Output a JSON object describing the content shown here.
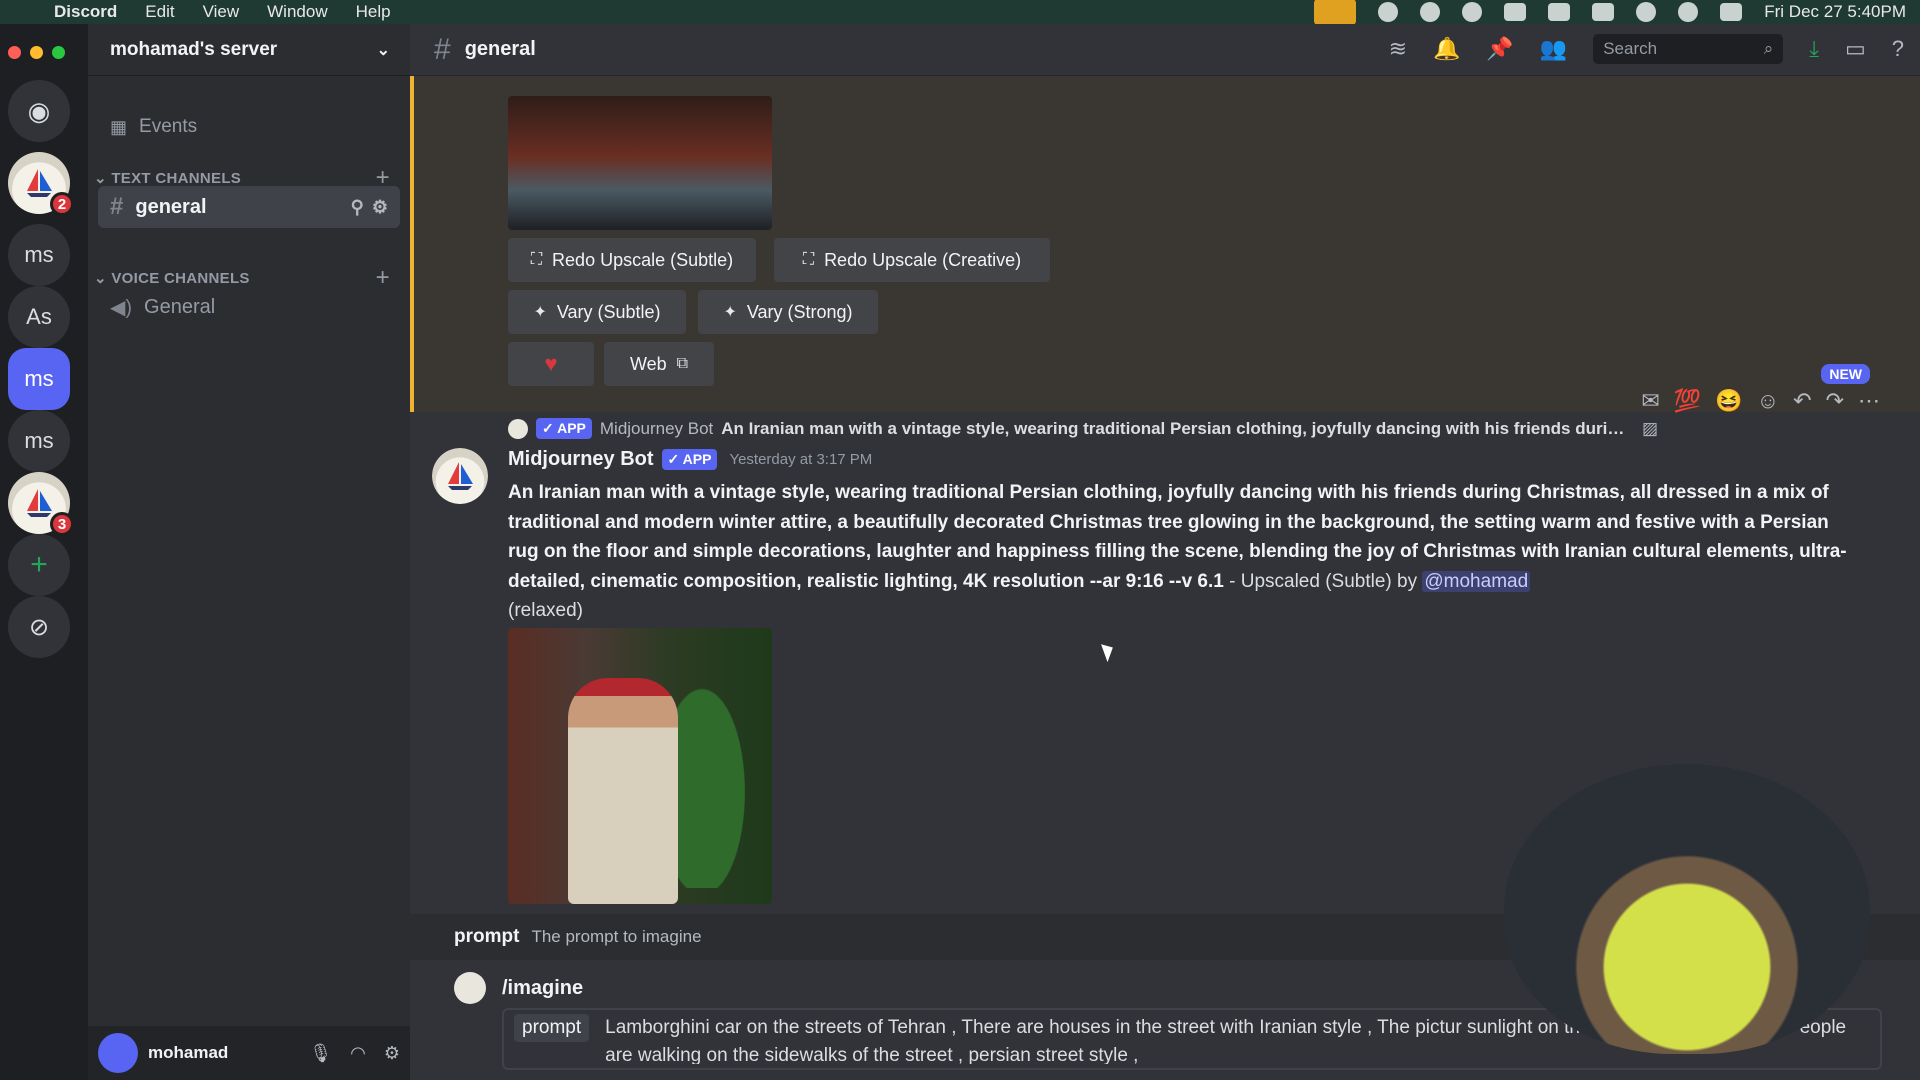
{
  "menubar": {
    "app": "Discord",
    "items": [
      "Edit",
      "View",
      "Window",
      "Help"
    ],
    "clock": "Fri Dec 27  5:40PM"
  },
  "rail": {
    "servers": [
      {
        "label": "",
        "badge": "2",
        "icon": "sailboat-icon"
      },
      {
        "label": "ms",
        "badge": ""
      },
      {
        "label": "As",
        "badge": ""
      },
      {
        "label": "ms",
        "badge": "",
        "selected": true
      },
      {
        "label": "ms",
        "badge": ""
      },
      {
        "label": "",
        "badge": "3",
        "icon": "sailboat-icon"
      }
    ],
    "add": "+",
    "explore": "compass-icon"
  },
  "sidebar": {
    "server_name": "mohamad's server",
    "events": "Events",
    "text_category": "TEXT CHANNELS",
    "voice_category": "VOICE CHANNELS",
    "text_channel": "general",
    "voice_channel": "General",
    "user": "mohamad"
  },
  "header": {
    "channel": "general",
    "search_placeholder": "Search"
  },
  "buttons": {
    "redo_subtle": "Redo Upscale (Subtle)",
    "redo_creative": "Redo Upscale (Creative)",
    "vary_subtle": "Vary (Subtle)",
    "vary_strong": "Vary (Strong)",
    "web": "Web"
  },
  "hover": {
    "new": "NEW"
  },
  "reply": {
    "app_tag": "✓ APP",
    "author": "Midjourney Bot",
    "prompt": "An Iranian man with a vintage style, wearing traditional Persian clothing, joyfully dancing with his friends during Christmas, all d..."
  },
  "message": {
    "author": "Midjourney Bot",
    "app_tag": "✓ APP",
    "time": "Yesterday at 3:17 PM",
    "prompt": "An Iranian man with a vintage style, wearing traditional Persian clothing, joyfully dancing with his friends during Christmas, all dressed in a mix of traditional and modern winter attire, a beautifully decorated Christmas tree glowing in the background, the setting warm and festive with a Persian rug on the floor and simple decorations, laughter and happiness filling the scene, blending the joy of Christmas with Iranian cultural elements, ultra-detailed, cinematic composition, realistic lighting, 4K resolution --ar 9:16 --v 6.1",
    "suffix": " - Upscaled (Subtle) by ",
    "mention": "@mohamad",
    "mode": "(relaxed)"
  },
  "command": {
    "hint_key": "prompt",
    "hint_desc": "The prompt to imagine",
    "name": "/imagine",
    "option": "prompt",
    "value": "Lamborghini car on the streets of Tehran , There are houses in the street with Iranian style , The pictur sunlight on the street is clear , iranian People are walking on the sidewalks of the street , persian street style ,"
  }
}
